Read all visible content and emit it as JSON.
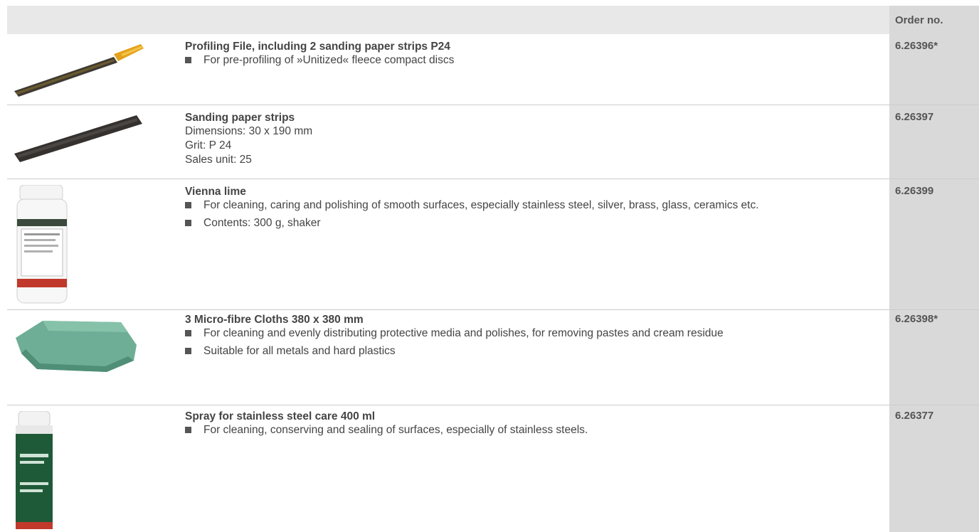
{
  "header": {
    "order_label": "Order no."
  },
  "products": [
    {
      "title": "Profiling File, including 2 sanding paper strips P24",
      "bullets": [
        "For pre-profiling of »Unitized« fleece compact discs"
      ],
      "order_no": "6.26396*",
      "icon": "profiling-file-image"
    },
    {
      "title": "Sanding paper strips",
      "lines": [
        "Dimensions: 30 x 190 mm",
        "Grit: P 24",
        "Sales unit: 25"
      ],
      "order_no": "6.26397",
      "icon": "sanding-strip-image"
    },
    {
      "title": "Vienna lime",
      "bullets": [
        "For cleaning, caring and polishing of smooth surfaces, especially stainless steel, silver, brass, glass, ceramics etc.",
        "Contents: 300 g, shaker"
      ],
      "order_no": "6.26399",
      "icon": "lime-bottle-image"
    },
    {
      "title": "3 Micro-fibre Cloths 380 x 380 mm",
      "bullets": [
        "For cleaning and evenly distributing protective media and polishes, for removing pastes and cream residue",
        "Suitable for all metals and hard plastics"
      ],
      "order_no": "6.26398*",
      "icon": "microfibre-cloth-image"
    },
    {
      "title": "Spray for stainless steel care 400 ml",
      "bullets": [
        "For cleaning, conserving and sealing of surfaces, especially of stainless steels."
      ],
      "order_no": "6.26377",
      "icon": "spray-can-image"
    }
  ],
  "colors": {
    "order_column": "#d9d9d9",
    "header": "#e8e8e8",
    "text": "#444444"
  }
}
